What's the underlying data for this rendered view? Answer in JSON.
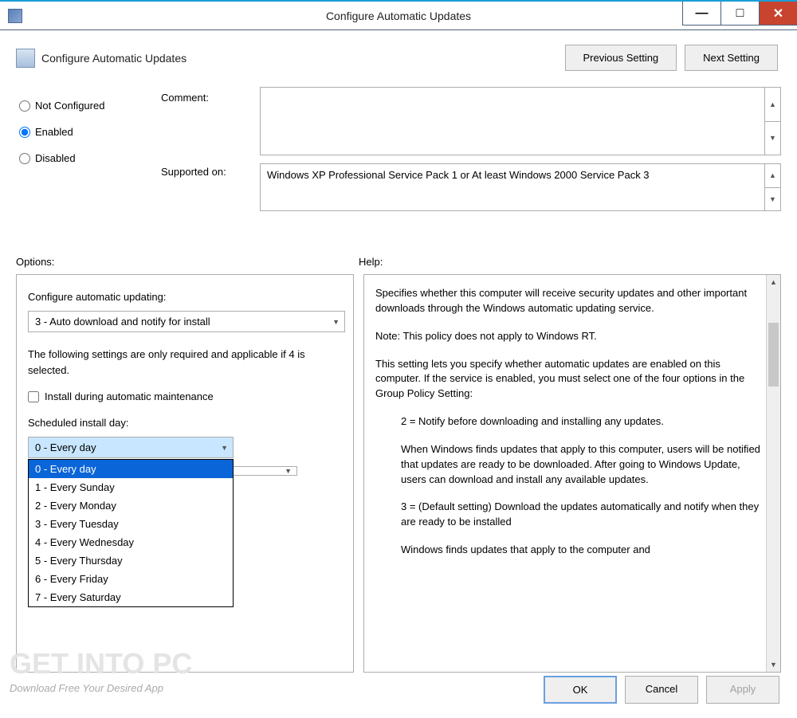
{
  "titlebar": {
    "title": "Configure Automatic Updates"
  },
  "winbtns": {
    "min": "—",
    "max": "□",
    "close": "✕"
  },
  "header": {
    "policy_name": "Configure Automatic Updates",
    "prev": "Previous Setting",
    "next": "Next Setting"
  },
  "state": {
    "not_configured": "Not Configured",
    "enabled": "Enabled",
    "disabled": "Disabled",
    "selected": "Enabled"
  },
  "labels": {
    "comment": "Comment:",
    "supported": "Supported on:",
    "options": "Options:",
    "help": "Help:"
  },
  "supported_on": "Windows XP Professional Service Pack 1 or At least Windows 2000 Service Pack 3",
  "options": {
    "configure_label": "Configure automatic updating:",
    "configure_value": "3 - Auto download and notify for install",
    "note": "The following settings are only required and applicable if 4 is selected.",
    "install_maint": "Install during automatic maintenance",
    "day_label": "Scheduled install day:",
    "day_value": "0 - Every day",
    "day_items": [
      "0 - Every day",
      "1 - Every Sunday",
      "2 - Every Monday",
      "3 - Every Tuesday",
      "4 - Every Wednesday",
      "5 - Every Thursday",
      "6 - Every Friday",
      "7 - Every Saturday"
    ]
  },
  "help": {
    "p1": "Specifies whether this computer will receive security updates and other important downloads through the Windows automatic updating service.",
    "p2": "Note: This policy does not apply to Windows RT.",
    "p3": "This setting lets you specify whether automatic updates are enabled on this computer. If the service is enabled, you must select one of the four options in the Group Policy Setting:",
    "p4": "2 = Notify before downloading and installing any updates.",
    "p5": "When Windows finds updates that apply to this computer, users will be notified that updates are ready to be downloaded. After going to Windows Update, users can download and install any available updates.",
    "p6": "3 = (Default setting) Download the updates automatically and notify when they are ready to be installed",
    "p7": "Windows finds updates that apply to the computer and"
  },
  "footer": {
    "ok": "OK",
    "cancel": "Cancel",
    "apply": "Apply"
  },
  "watermark": {
    "big": "GET INTO PC",
    "small": "Download Free Your Desired App"
  }
}
